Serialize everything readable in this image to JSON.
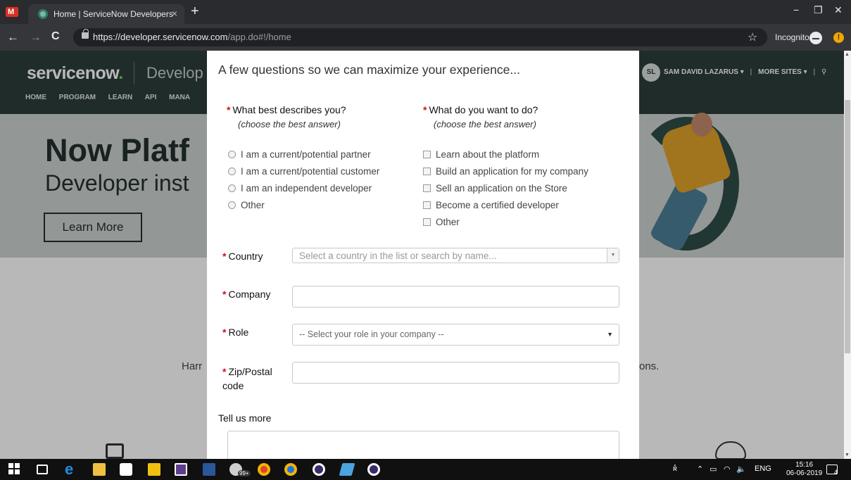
{
  "browser": {
    "gmail_letter": "M",
    "tab_title": "Home | ServiceNow Developers",
    "tab_close": "×",
    "new_tab": "+",
    "window_controls": {
      "minimize": "−",
      "restore": "❐",
      "close": "✕"
    },
    "nav": {
      "back": "←",
      "forward": "→",
      "reload": "C"
    },
    "url_host": "https://developer.servicenow.com",
    "url_path": "/app.do#!/home",
    "bookmark_star": "☆",
    "incognito_label": "Incognito",
    "extension_badge": "!"
  },
  "site": {
    "logo_text": "servicenow",
    "logo_dot": ".",
    "logo_suffix": "Develop",
    "nav": [
      "HOME",
      "PROGRAM",
      "LEARN",
      "API",
      "MANA"
    ],
    "avatar": "SL",
    "user_name": "SAM DAVID LAZARUS ▾",
    "divider": "|",
    "more_sites": "MORE SITES ▾",
    "search_icon": "⚲",
    "hero_title": "Now Platf",
    "hero_subtitle": "Developer inst",
    "hero_button": "Learn More",
    "page_text_left": "Harr",
    "page_text_right": "ons."
  },
  "modal": {
    "title": "A few questions so we can maximize your experience...",
    "required_mark": "*",
    "q1": {
      "heading": "What best describes you?",
      "sub": "(choose the best answer)",
      "options": [
        "I am a current/potential partner",
        "I am a current/potential customer",
        "I am an independent developer",
        "Other"
      ]
    },
    "q2": {
      "heading": "What do you want to do?",
      "sub": "(choose the best answer)",
      "options": [
        "Learn about the platform",
        "Build an application for my company",
        "Sell an application on the Store",
        "Become a certified developer",
        "Other"
      ]
    },
    "country_label": "Country",
    "country_placeholder": "Select a country in the list or search by name...",
    "company_label": "Company",
    "company_value": "",
    "role_label": "Role",
    "role_value": "-- Select your role in your company --",
    "zip_label_1": "Zip/Postal",
    "zip_label_2": "code",
    "zip_value": "",
    "tell_more_label": "Tell us more"
  },
  "taskbar": {
    "badge_count": "99+",
    "language": "ENG",
    "time": "15:16",
    "date": "06-06-2019",
    "notification_count": "4"
  },
  "colors": {
    "site_header": "#2d3d3a",
    "hero_bg": "#ccd2cf",
    "required": "#d0101e",
    "brand_green": "#62d84e"
  }
}
